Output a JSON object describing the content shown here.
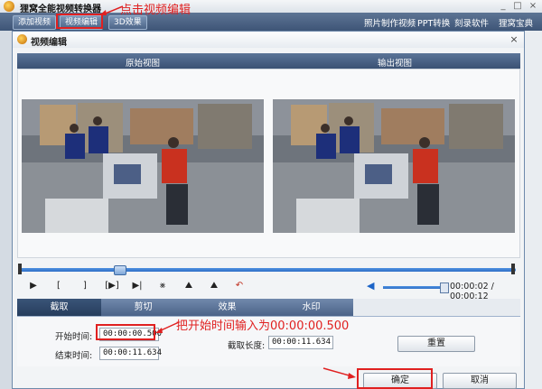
{
  "app": {
    "title": "狸窝全能视频转换器",
    "toolbar": {
      "add_video": "添加视频",
      "edit_video": "视频编辑",
      "effect_3d": "3D效果"
    },
    "menu": [
      "照片制作视频",
      "PPT转换",
      "刻录软件",
      "狸窝宝典"
    ],
    "window_buttons": [
      "_",
      "□",
      "×"
    ]
  },
  "annotations": {
    "top": "点击视频编辑",
    "start_time_hint": "把开始时间输入为00:00:00.500"
  },
  "dialog": {
    "title": "视频编辑",
    "close": "×",
    "headers": {
      "original": "原始视图",
      "output": "输出视图"
    },
    "seek_progress": 0.2,
    "controls": [
      "▶",
      "[",
      "]",
      "[▶]",
      "▶|",
      "⨳",
      "⛰",
      "⛰",
      "↶"
    ],
    "volume_level": 0.95,
    "time": "00:00:02 / 00:00:12",
    "tabs": [
      "截取",
      "剪切",
      "效果",
      "水印"
    ],
    "active_tab": 0,
    "trim": {
      "start_label": "开始时间:",
      "start_value": "00:00:00.500",
      "end_label": "结束时间:",
      "end_value": "00:00:11.634",
      "length_label": "截取长度:",
      "length_value": "00:00:11.634",
      "reset": "重置"
    },
    "ok": "确定",
    "cancel": "取消"
  },
  "colors": {
    "annotation": "#e02020",
    "toolbar_bg": "#4d6689",
    "progress_fill": "#2f6fc7"
  }
}
